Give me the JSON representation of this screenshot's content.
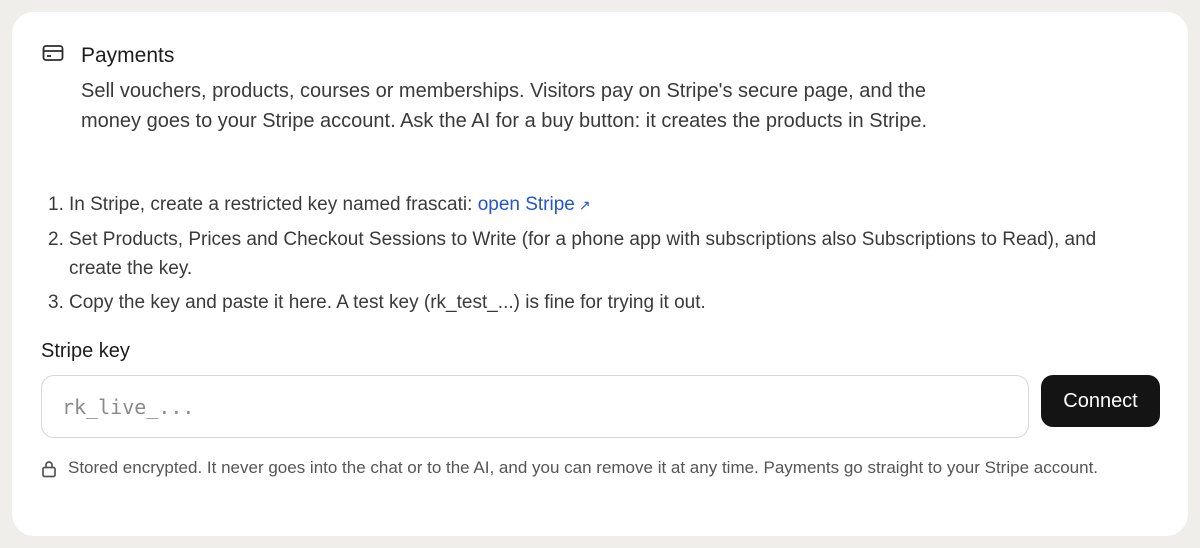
{
  "section": {
    "icon": "credit-card-icon",
    "title": "Payments",
    "description": "Sell vouchers, products, courses or memberships. Visitors pay on Stripe's secure page, and the money goes to your Stripe account. Ask the AI for a buy button: it creates the products in Stripe."
  },
  "steps": [
    {
      "number": "1.",
      "text": "In Stripe, create a restricted key named frascati: ",
      "link": "open Stripe",
      "link_icon": "external-arrow-icon"
    },
    {
      "number": "2.",
      "text": "Set Products, Prices and Checkout Sessions to Write (for a phone app with subscriptions also Subscriptions to Read), and create the key."
    },
    {
      "number": "3.",
      "text": "Copy the key and paste it here. A test key (rk_test_...) is fine for trying it out."
    }
  ],
  "key_field": {
    "label": "Stripe key",
    "value": "",
    "placeholder": "rk_live_..."
  },
  "connect_button": {
    "label": "Connect"
  },
  "note": {
    "icon": "lock-icon",
    "text": "Stored encrypted. It never goes into the chat or to the AI, and you can remove it at any time. Payments go straight to your Stripe account."
  },
  "colors": {
    "background": "#efeeea",
    "card": "#ffffff",
    "link": "#2456c9",
    "button": "#141414"
  }
}
